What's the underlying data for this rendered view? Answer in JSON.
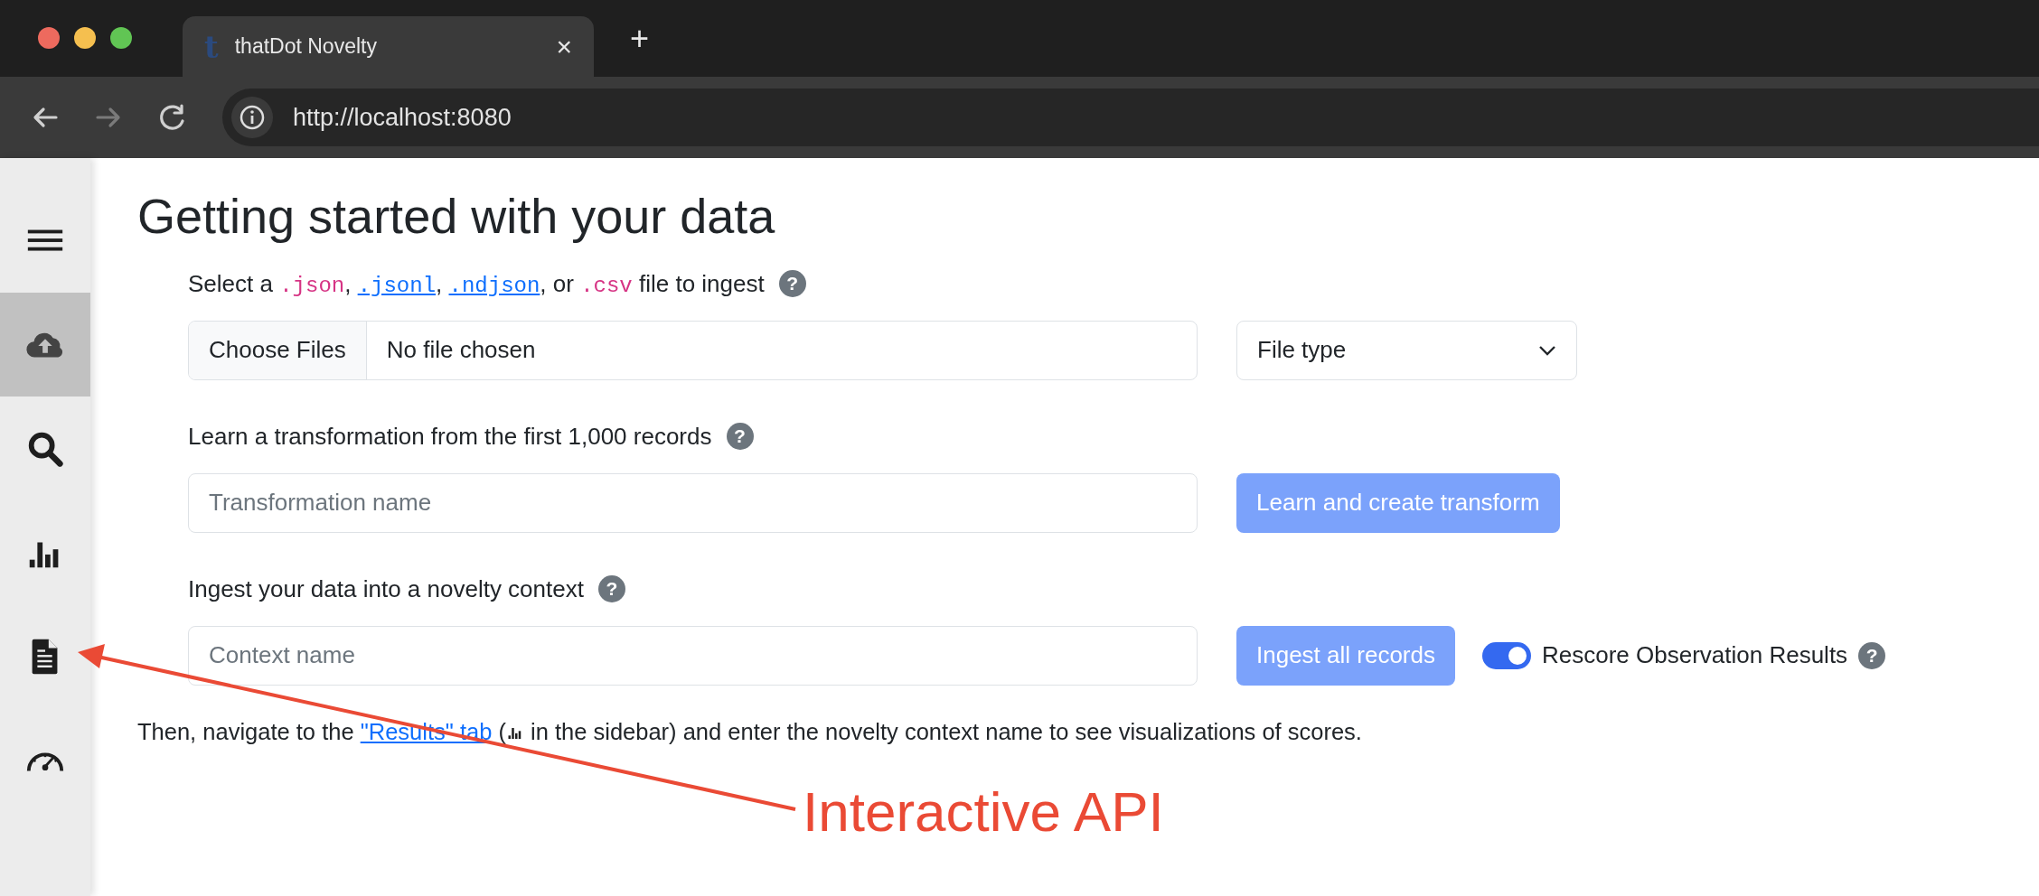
{
  "browser": {
    "window_controls": [
      {
        "color": "#ed6a5e"
      },
      {
        "color": "#f5bf4f"
      },
      {
        "color": "#61c554"
      }
    ],
    "tab": {
      "favicon": "t",
      "title": "thatDot Novelty",
      "close": "×",
      "selected": true
    },
    "new_tab": "+",
    "nav_buttons": [
      {
        "kind": "back",
        "disabled": false
      },
      {
        "kind": "forward",
        "disabled": true
      },
      {
        "kind": "reload",
        "disabled": false
      }
    ],
    "url": "http://localhost:8080"
  },
  "sidebar": {
    "items": [
      {
        "kind": "menu",
        "selected": false
      },
      {
        "kind": "upload",
        "selected": true
      },
      {
        "kind": "search",
        "selected": false
      },
      {
        "kind": "chart",
        "selected": false
      },
      {
        "kind": "document",
        "selected": false
      },
      {
        "kind": "gauge",
        "selected": false
      }
    ]
  },
  "page": {
    "title": "Getting started with your data",
    "steps": [
      {
        "label": [
          {
            "kind": "text",
            "text": "Select a "
          },
          {
            "kind": "code",
            "text": ".json"
          },
          {
            "kind": "text",
            "text": ", "
          },
          {
            "kind": "code_link",
            "text": ".jsonl"
          },
          {
            "kind": "text",
            "text": ", "
          },
          {
            "kind": "code_link",
            "text": ".ndjson"
          },
          {
            "kind": "text",
            "text": ", or "
          },
          {
            "kind": "code",
            "text": ".csv"
          },
          {
            "kind": "text",
            "text": " file to ingest"
          }
        ],
        "help": "?",
        "controls": [
          {
            "kind": "file",
            "button": "Choose Files",
            "value": "No file chosen"
          },
          {
            "kind": "select",
            "value": "File type"
          }
        ]
      },
      {
        "label": [
          {
            "kind": "text",
            "text": "Learn a transformation from the first 1,000 records"
          }
        ],
        "help": "?",
        "controls": [
          {
            "kind": "input",
            "placeholder": "Transformation name"
          },
          {
            "kind": "button",
            "label": "Learn and create transform",
            "disabled": true
          }
        ]
      },
      {
        "label": [
          {
            "kind": "text",
            "text": "Ingest your data into a novelty context"
          }
        ],
        "help": "?",
        "controls": [
          {
            "kind": "input",
            "placeholder": "Context name"
          },
          {
            "kind": "button",
            "label": "Ingest all records",
            "disabled": true
          },
          {
            "kind": "toggle",
            "label": "Rescore Observation Results",
            "on": true,
            "help": "?"
          }
        ]
      }
    ],
    "note": [
      {
        "kind": "text",
        "text": "Then, navigate to the "
      },
      {
        "kind": "link",
        "text": "\"Results\" tab"
      },
      {
        "kind": "text",
        "text": " ("
      },
      {
        "kind": "chart_icon"
      },
      {
        "kind": "text",
        "text": " in the sidebar) and enter the novelty context name to see visualizations of scores."
      }
    ]
  },
  "annotation": {
    "text": "Interactive API"
  }
}
